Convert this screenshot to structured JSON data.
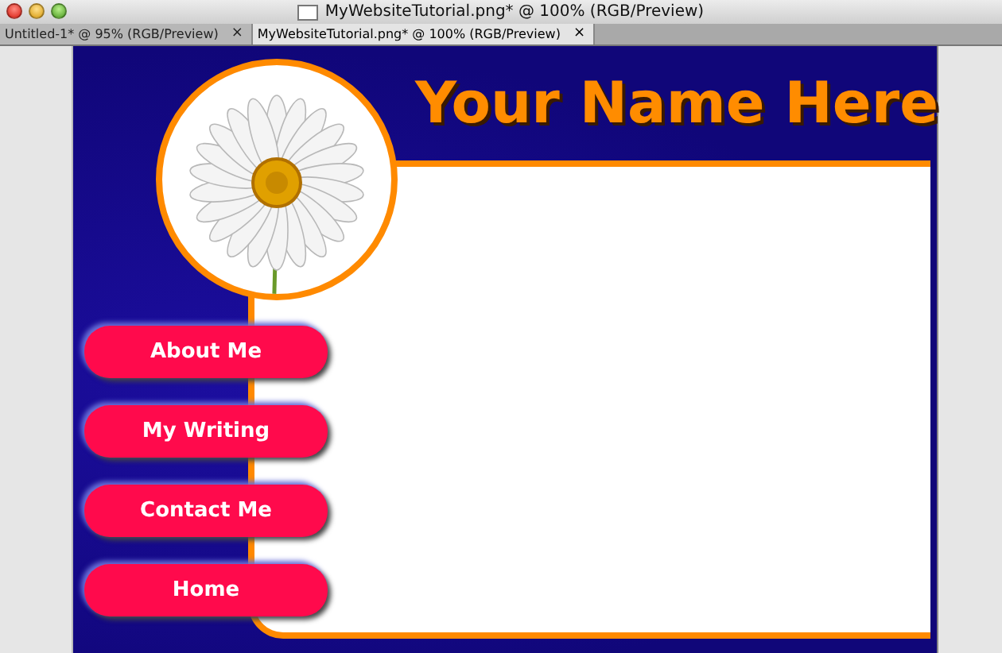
{
  "window": {
    "title": "MyWebsiteTutorial.png* @ 100% (RGB/Preview)"
  },
  "tabs": [
    {
      "label": "Untitled-1* @ 95% (RGB/Preview)",
      "close": "×",
      "selected": false
    },
    {
      "label": "MyWebsiteTutorial.png* @ 100% (RGB/Preview)",
      "close": "×",
      "selected": true
    }
  ],
  "site": {
    "title": "Your Name Here",
    "nav": [
      "About Me",
      "My Writing",
      "Contact Me",
      "Home"
    ]
  }
}
